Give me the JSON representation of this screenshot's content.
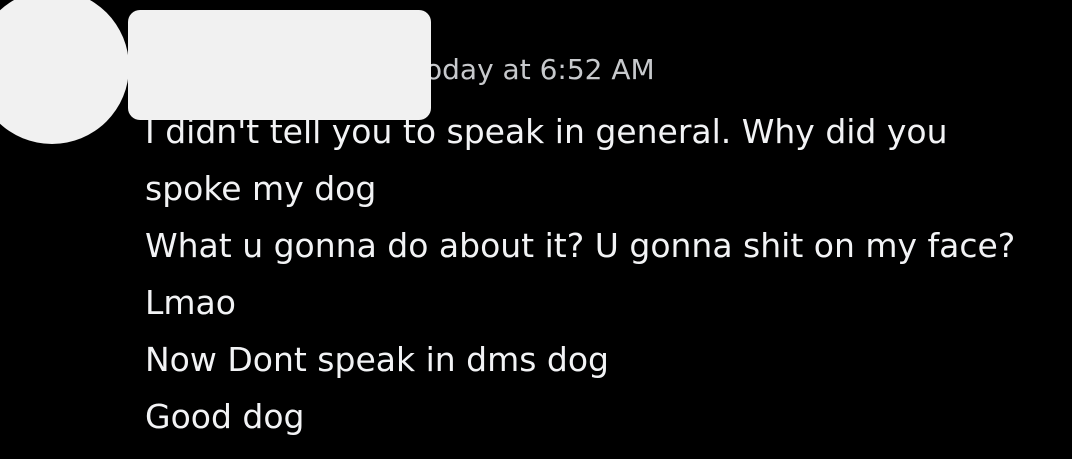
{
  "message_group": {
    "timestamp": "oday at 6:52 AM",
    "messages": [
      "I didn't tell you to speak in general. Why did you spoke my dog",
      "What u gonna do about it? U gonna shit on my face?",
      "Lmao",
      "Now Dont speak in dms dog",
      "Good dog"
    ]
  },
  "colors": {
    "background": "#000000",
    "message_text": "#f2f3f5",
    "timestamp_text": "#c7c9cc",
    "redaction": "#f1f1f1"
  }
}
